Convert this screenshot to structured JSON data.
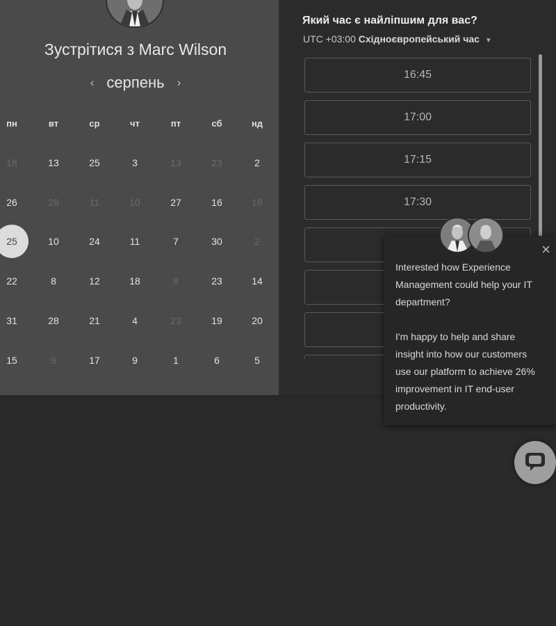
{
  "calendar": {
    "title_prefix": "Зустрітися з",
    "host_name": "Marc Wilson",
    "month": "серпень",
    "prev_icon": "‹",
    "next_icon": "›",
    "weekdays": [
      "пн",
      "вт",
      "ср",
      "чт",
      "пт",
      "сб",
      "нд"
    ],
    "weeks": [
      [
        {
          "d": "18",
          "dim": true
        },
        {
          "d": "13"
        },
        {
          "d": "25"
        },
        {
          "d": "3"
        },
        {
          "d": "13",
          "dim": true
        },
        {
          "d": "23",
          "dim": true
        },
        {
          "d": "2"
        }
      ],
      [
        {
          "d": "26"
        },
        {
          "d": "28",
          "dim": true
        },
        {
          "d": "11",
          "dim": true
        },
        {
          "d": "10",
          "dim": true
        },
        {
          "d": "27"
        },
        {
          "d": "16"
        },
        {
          "d": "16",
          "dim": true
        }
      ],
      [
        {
          "d": "25",
          "selected": true
        },
        {
          "d": "10"
        },
        {
          "d": "24"
        },
        {
          "d": "11"
        },
        {
          "d": "7"
        },
        {
          "d": "30"
        },
        {
          "d": "2",
          "dim": true
        }
      ],
      [
        {
          "d": "22"
        },
        {
          "d": "8"
        },
        {
          "d": "12"
        },
        {
          "d": "18"
        },
        {
          "d": "8",
          "dim": true
        },
        {
          "d": "23"
        },
        {
          "d": "14"
        }
      ],
      [
        {
          "d": "31"
        },
        {
          "d": "28"
        },
        {
          "d": "21"
        },
        {
          "d": "4"
        },
        {
          "d": "23",
          "dim": true
        },
        {
          "d": "19"
        },
        {
          "d": "20"
        }
      ],
      [
        {
          "d": "15"
        },
        {
          "d": "9",
          "dim": true
        },
        {
          "d": "17"
        },
        {
          "d": "9"
        },
        {
          "d": "1"
        },
        {
          "d": "6"
        },
        {
          "d": "5"
        }
      ]
    ]
  },
  "times": {
    "question": "Який час є найліпшим для вас?",
    "timezone_offset": "UTC +03:00",
    "timezone_name": "Східноєвропейський час",
    "slots": [
      "16:45",
      "17:00",
      "17:15",
      "17:30",
      "",
      "",
      "",
      ""
    ]
  },
  "popup": {
    "paragraph1": "Interested how Experience Management could help your IT department?",
    "paragraph2": "I'm happy to help and share insight into how our customers use our platform to achieve 26% improvement in IT end-user productivity.",
    "close_icon": "×"
  },
  "colors": {
    "left_panel": "#4a4a4a",
    "right_panel": "#2b2b2b",
    "selected_day": "#dcdcdc"
  }
}
